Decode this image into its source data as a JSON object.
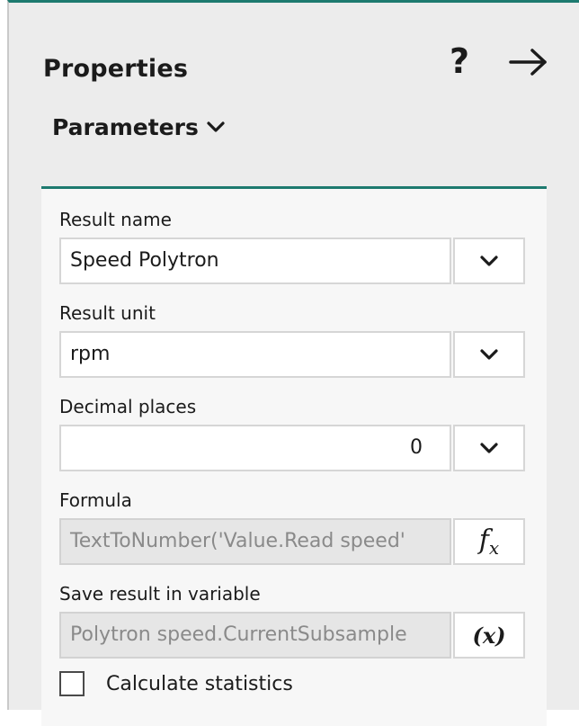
{
  "panel": {
    "title": "Properties",
    "help_label": "?",
    "collapse_icon": "arrow-right-icon",
    "accent_color": "#1d7a6f"
  },
  "section": {
    "label": "Parameters",
    "chevron_icon": "chevron-down-icon"
  },
  "fields": {
    "result_name": {
      "label": "Result name",
      "value": "Speed Polytron"
    },
    "result_unit": {
      "label": "Result unit",
      "value": "rpm"
    },
    "decimal_places": {
      "label": "Decimal places",
      "value": "0"
    },
    "formula": {
      "label": "Formula",
      "value": "TextToNumber('Value.Read speed'",
      "button_f": "f",
      "button_x": "x"
    },
    "save_variable": {
      "label": "Save result in variable",
      "value": "Polytron speed.CurrentSubsample",
      "button_label": "(x)"
    }
  },
  "statistics": {
    "label": "Calculate statistics",
    "checked": false
  }
}
